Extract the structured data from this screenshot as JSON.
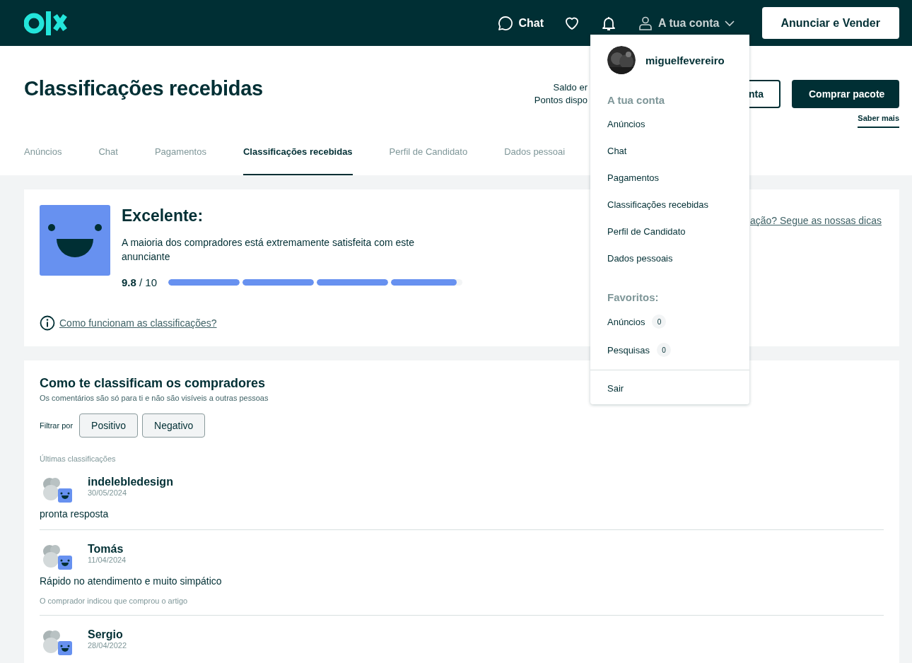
{
  "header": {
    "nav": [
      {
        "kind": "chat",
        "label": "Chat"
      },
      {
        "kind": "favorites"
      },
      {
        "kind": "notifications"
      },
      {
        "kind": "account",
        "label": "A tua conta"
      }
    ],
    "post_button": "Anunciar e Vender"
  },
  "page_title": "Classificações recebidas",
  "balance": {
    "lines": [
      "Saldo er",
      "Pontos dispo"
    ],
    "outline_button": "nta",
    "buy_button": "Comprar pacote",
    "link": "Saber mais"
  },
  "tabs": [
    {
      "label": "Anúncios",
      "selected": false
    },
    {
      "label": "Chat",
      "selected": false
    },
    {
      "label": "Pagamentos",
      "selected": false
    },
    {
      "label": "Classificações recebidas",
      "selected": true
    },
    {
      "label": "Perfil de Candidato",
      "selected": false
    },
    {
      "label": "Dados pessoai",
      "selected": false
    }
  ],
  "summary": {
    "title": "Excelente:",
    "description": "A maioria dos compradores está extremamente satisfeita com este anunciante",
    "score": "9.8",
    "max": "/ 10",
    "level": 0.98,
    "help_link": "Como funcionam as classificações?",
    "tips_link": "ação? Segue as nossas dicas"
  },
  "reviews_section": {
    "title": "Como te classificam os compradores",
    "subtitle": "Os comentários são só para ti e não são visíveis a outras pessoas",
    "filter_label": "Filtrar por",
    "filters": [
      {
        "label": "Positivo",
        "selected": false
      },
      {
        "label": "Negativo",
        "selected": false
      }
    ],
    "list_title": "Últimas classificações",
    "reviews": [
      {
        "author": "indelebledesign",
        "date": "30/05/2024",
        "comment": "pronta resposta"
      },
      {
        "author": "Tomás",
        "date": "11/04/2024",
        "comment": "Rápido no atendimento e muito simpático",
        "note": "O comprador indicou que comprou o artigo"
      },
      {
        "author": "Sergio",
        "date": "28/04/2022"
      }
    ]
  },
  "account_menu": {
    "username": "miguelfevereiro",
    "sections": [
      {
        "title": "A tua conta",
        "items": [
          {
            "label": "Anúncios"
          },
          {
            "label": "Chat"
          },
          {
            "label": "Pagamentos"
          },
          {
            "label": "Classificações recebidas"
          },
          {
            "label": "Perfil de Candidato"
          },
          {
            "label": "Dados pessoais"
          }
        ]
      },
      {
        "title": "Favoritos:",
        "items": [
          {
            "label": "Anúncios",
            "count": "0"
          },
          {
            "label": "Pesquisas",
            "count": "0"
          }
        ]
      }
    ],
    "logout": "Sair"
  }
}
